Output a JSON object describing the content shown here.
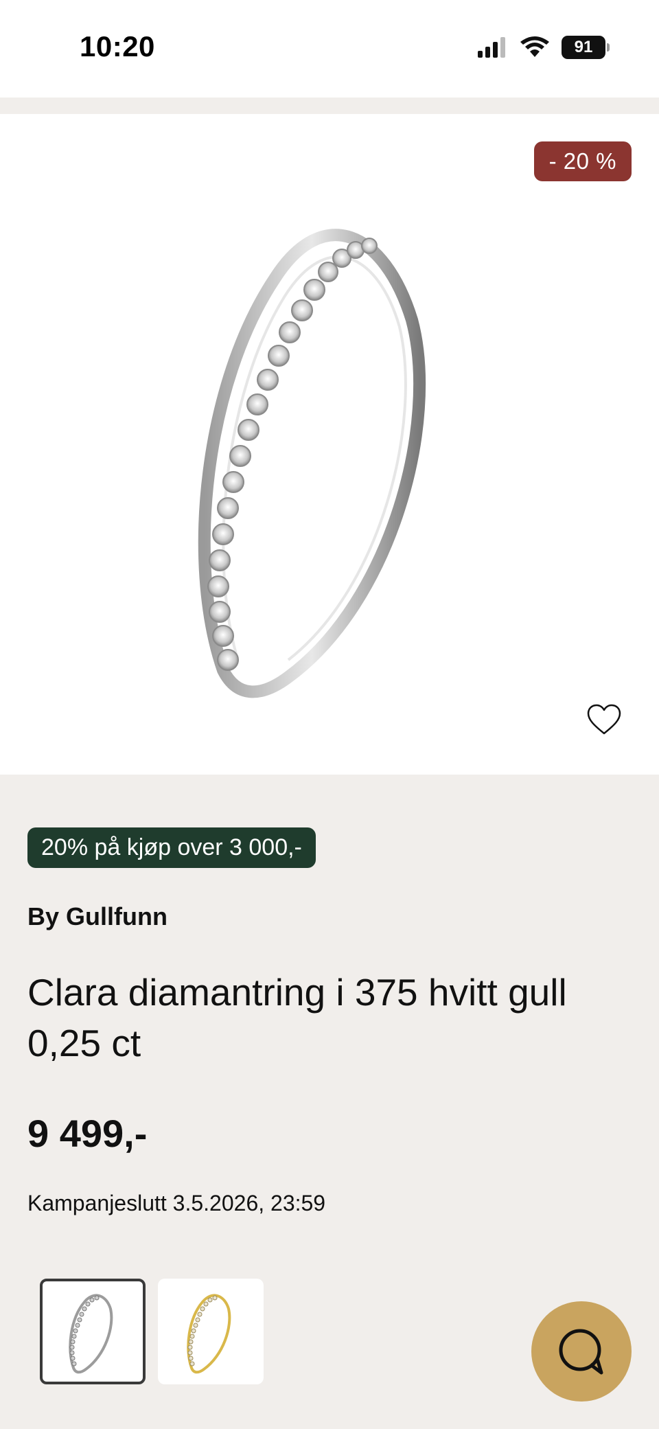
{
  "status_bar": {
    "time": "10:20",
    "battery": "91",
    "icons": [
      "signal-icon",
      "wifi-icon",
      "battery-icon"
    ]
  },
  "product": {
    "discount_badge": "- 20 %",
    "promo": "20% på kjøp over 3 000,-",
    "brand": "By Gullfunn",
    "title": "Clara diamantring i 375 hvitt gull 0,25 ct",
    "price": "9 499,-",
    "campaign_end": "Kampanjeslutt 3.5.2026, 23:59",
    "variants": [
      {
        "name": "white-gold",
        "selected": true
      },
      {
        "name": "yellow-gold",
        "selected": false
      }
    ]
  },
  "colors": {
    "discount_red": "#8b3530",
    "promo_green": "#1f3c2d",
    "chat_gold": "#c9a45f",
    "page_bg": "#f1eeeb"
  },
  "icons": {
    "favorite": "heart-icon",
    "chat": "chat-icon"
  }
}
